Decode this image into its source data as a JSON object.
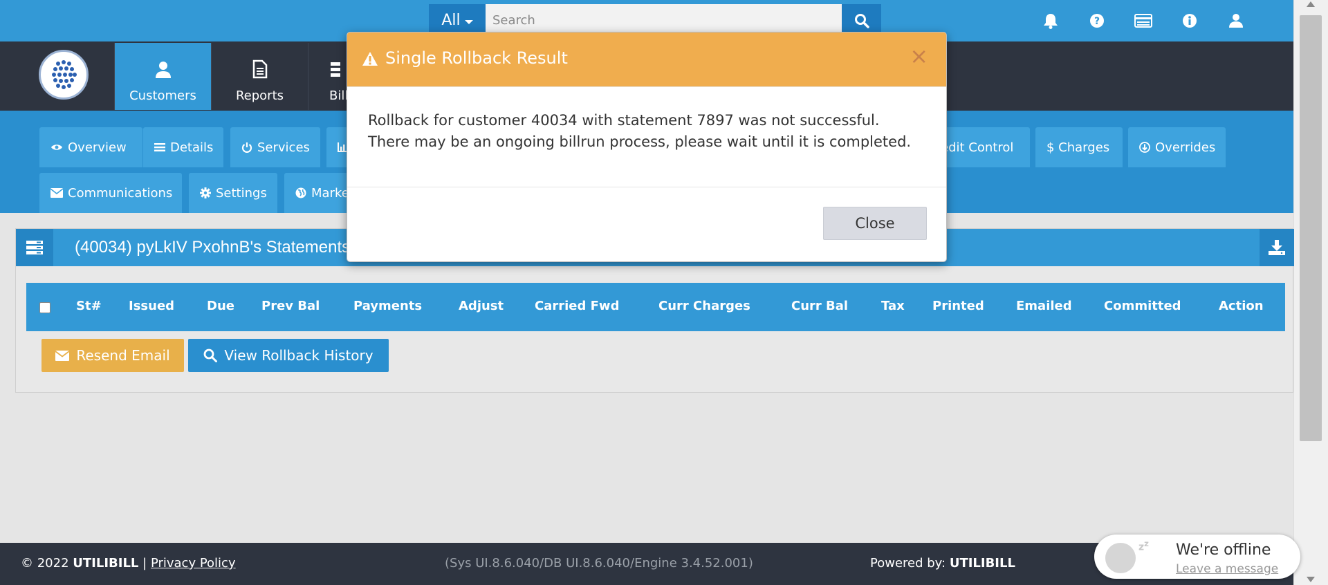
{
  "search": {
    "scope": "All",
    "placeholder": "Search"
  },
  "top_icons": [
    "bell-icon",
    "question-icon",
    "card-icon",
    "info-icon",
    "user-icon"
  ],
  "nav": {
    "items": [
      {
        "label": "Customers",
        "icon": "user-icon",
        "active": true
      },
      {
        "label": "Reports",
        "icon": "document-icon",
        "active": false
      },
      {
        "label": "Bill",
        "icon": "list-icon",
        "active": false
      }
    ]
  },
  "subnav": {
    "tabs": [
      {
        "label": "Overview",
        "icon": "eye-icon"
      },
      {
        "label": "Details",
        "icon": "list-icon"
      },
      {
        "label": "Services",
        "icon": "power-icon"
      },
      {
        "label": "",
        "icon": "chart-icon"
      },
      {
        "label": "edit Control",
        "icon": ""
      },
      {
        "label": "$ Charges",
        "icon": ""
      },
      {
        "label": "Overrides",
        "icon": "arrow-circle-icon"
      },
      {
        "label": "Communications",
        "icon": "envelope-icon"
      },
      {
        "label": "Settings",
        "icon": "gear-icon"
      },
      {
        "label": "Marke",
        "icon": "globe-icon"
      }
    ]
  },
  "panel": {
    "title": "(40034) pyLkIV PxohnB's Statements",
    "columns": [
      "St#",
      "Issued",
      "Due",
      "Prev Bal",
      "Payments",
      "Adjust",
      "Carried Fwd",
      "Curr Charges",
      "Curr Bal",
      "Tax",
      "Printed",
      "Emailed",
      "Committed",
      "Action"
    ],
    "resend_label": "Resend Email",
    "history_label": "View Rollback History"
  },
  "footer": {
    "copyright_prefix": "© 2022",
    "brand": "UTILIBILL",
    "separator": "|",
    "privacy": "Privacy Policy",
    "version": "(Sys UI.8.6.040/DB UI.8.6.040/Engine 3.4.52.001)",
    "powered_prefix": "Powered by:",
    "powered_brand": "UTILIBILL"
  },
  "chat": {
    "status": "We're offline",
    "link": "Leave a message"
  },
  "modal": {
    "title": "Single Rollback Result",
    "close_glyph": "×",
    "line1": "Rollback for customer 40034 with statement 7897 was not successful.",
    "line2": "There may be an ongoing billrun process, please wait until it is completed.",
    "close_label": "Close"
  },
  "colors": {
    "primary": "#3399d6",
    "nav_dark": "#2e3440",
    "warning": "#f0ad4e",
    "resend": "#e8b04a"
  }
}
